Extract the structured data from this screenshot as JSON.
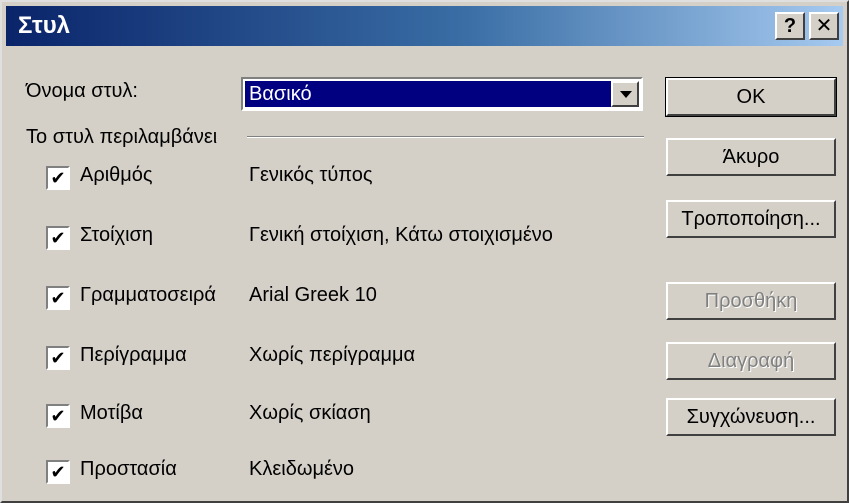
{
  "window": {
    "title": "Στυλ",
    "help_label": "?",
    "close_label": "✕"
  },
  "style_name": {
    "label": "Όνομα στυλ:",
    "value": "Βασικό"
  },
  "group": {
    "label": "Το στυλ περιλαμβάνει"
  },
  "options": [
    {
      "label": "Αριθμός",
      "description": "Γενικός τύπος",
      "checked": true
    },
    {
      "label": "Στοίχιση",
      "description": "Γενική στοίχιση, Κάτω στοιχισμένο",
      "checked": true
    },
    {
      "label": "Γραμματοσειρά",
      "description": "Arial Greek 10",
      "checked": true
    },
    {
      "label": "Περίγραμμα",
      "description": "Χωρίς περίγραμμα",
      "checked": true
    },
    {
      "label": "Μοτίβα",
      "description": "Χωρίς σκίαση",
      "checked": true
    },
    {
      "label": "Προστασία",
      "description": "Κλειδωμένο",
      "checked": true
    }
  ],
  "checkmark": "✔",
  "buttons": {
    "ok": "OK",
    "cancel": "Άκυρο",
    "modify": "Τροποποίηση...",
    "add": "Προσθήκη",
    "delete": "Διαγραφή",
    "merge": "Συγχώνευση..."
  },
  "colors": {
    "titlebar_start": "#0a246a",
    "titlebar_end": "#a6caf0",
    "face": "#d4d0c8",
    "selection": "#000080"
  }
}
